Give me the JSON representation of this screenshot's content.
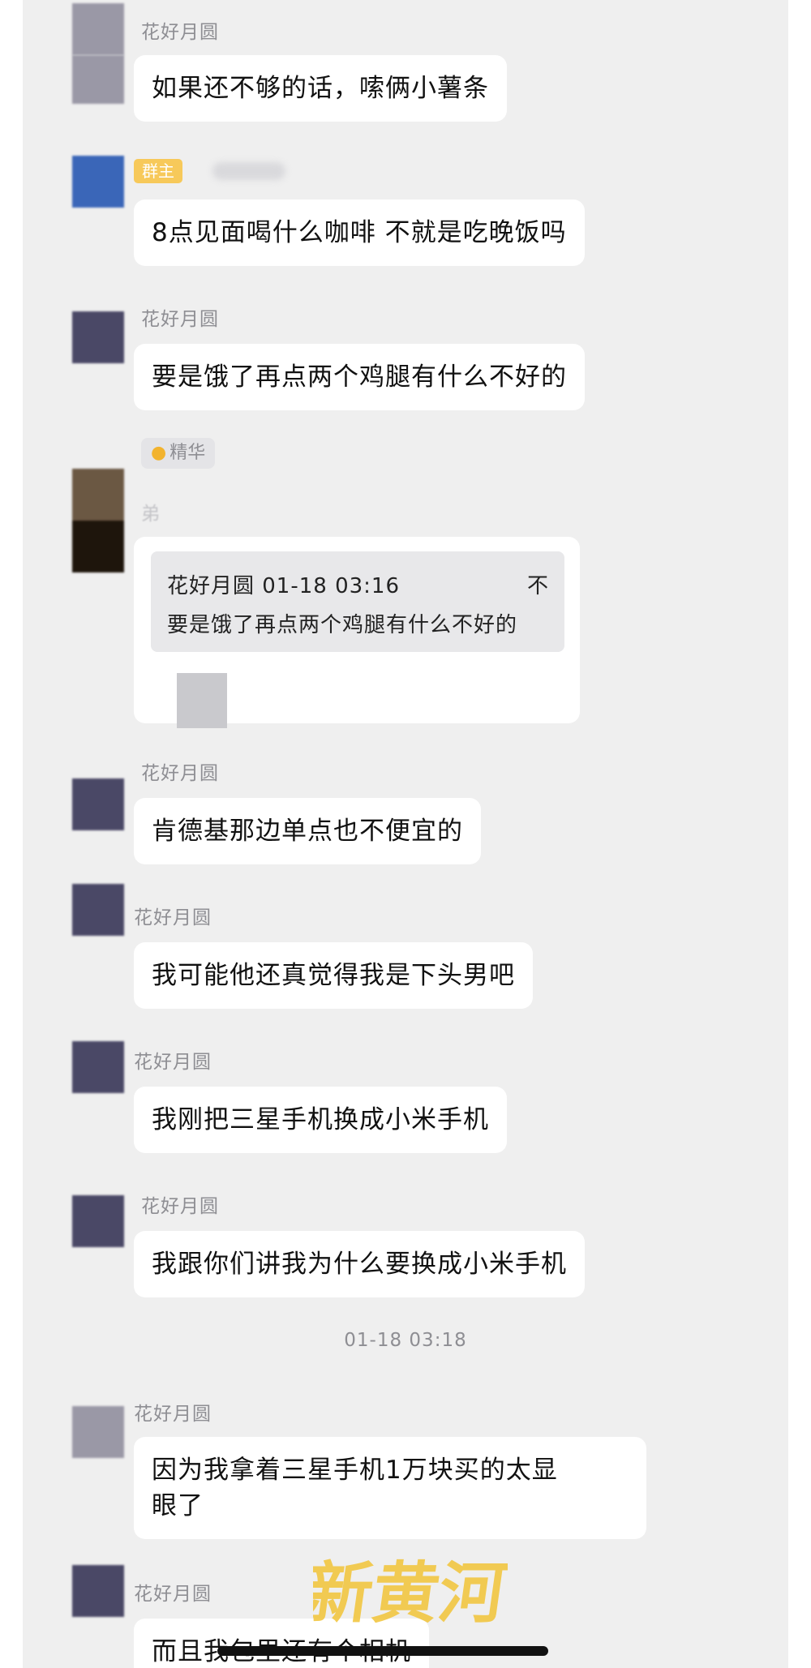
{
  "chat": {
    "messages": [
      {
        "sender": "花好月圆",
        "text": "如果还不够的话，嗦俩小薯条"
      },
      {
        "sender": "",
        "badge": "群主",
        "text": "8点见面喝什么咖啡 不就是吃晚饭吗"
      },
      {
        "sender": "花好月圆",
        "text": "要是饿了再点两个鸡腿有什么不好的"
      },
      {
        "sender": "花好月圆",
        "text": "肯德基那边单点也不便宜的"
      },
      {
        "sender": "花好月圆",
        "text": "我可能他还真觉得我是下头男吧"
      },
      {
        "sender": "花好月圆",
        "text": "我刚把三星手机换成小米手机"
      },
      {
        "sender": "花好月圆",
        "text": "我跟你们讲我为什么要换成小米手机"
      },
      {
        "sender": "花好月圆",
        "text": "因为我拿着三星手机1万块买的太显\n眼了"
      },
      {
        "sender": "花好月圆",
        "text": "而且我包里还有个相机"
      }
    ],
    "essence_tag": "精华",
    "reply_sender_partial": "弟",
    "quote": {
      "meta": "花好月圆 01-18 03:16",
      "close": "不",
      "text": "要是饿了再点两个鸡腿有什么不好的"
    },
    "timestamp": "01-18 03:18"
  },
  "watermark": "新黄河",
  "colors": {
    "background": "#efefef",
    "bubble": "#ffffff",
    "owner_badge": "#f7c95a",
    "watermark": "#f2c53d"
  }
}
